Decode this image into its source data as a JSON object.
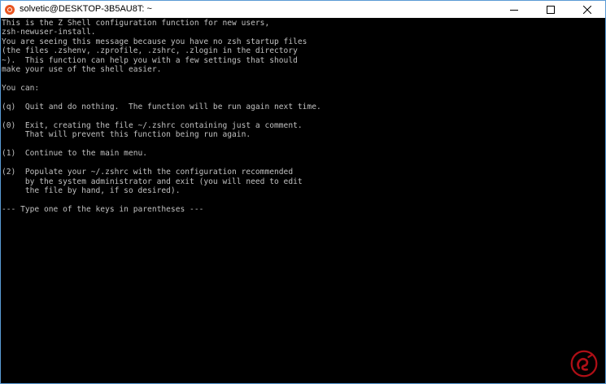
{
  "window": {
    "title": "solvetic@DESKTOP-3B5AU8T: ~",
    "app_icon": "ubuntu-icon",
    "controls": [
      "minimize-icon",
      "maximize-icon",
      "close-icon"
    ]
  },
  "terminal": {
    "background": "#000000",
    "foreground": "#c0c0c0",
    "lines": [
      "This is the Z Shell configuration function for new users,",
      "zsh-newuser-install.",
      "You are seeing this message because you have no zsh startup files",
      "(the files .zshenv, .zprofile, .zshrc, .zlogin in the directory",
      "~).  This function can help you with a few settings that should",
      "make your use of the shell easier.",
      "",
      "You can:",
      "",
      "(q)  Quit and do nothing.  The function will be run again next time.",
      "",
      "(0)  Exit, creating the file ~/.zshrc containing just a comment.",
      "     That will prevent this function being run again.",
      "",
      "(1)  Continue to the main menu.",
      "",
      "(2)  Populate your ~/.zshrc with the configuration recommended",
      "     by the system administrator and exit (you will need to edit",
      "     the file by hand, if so desired).",
      "",
      "--- Type one of the keys in parentheses ---"
    ]
  },
  "watermark": {
    "icon": "solvetic-logo-icon",
    "color": "#e8141e"
  }
}
